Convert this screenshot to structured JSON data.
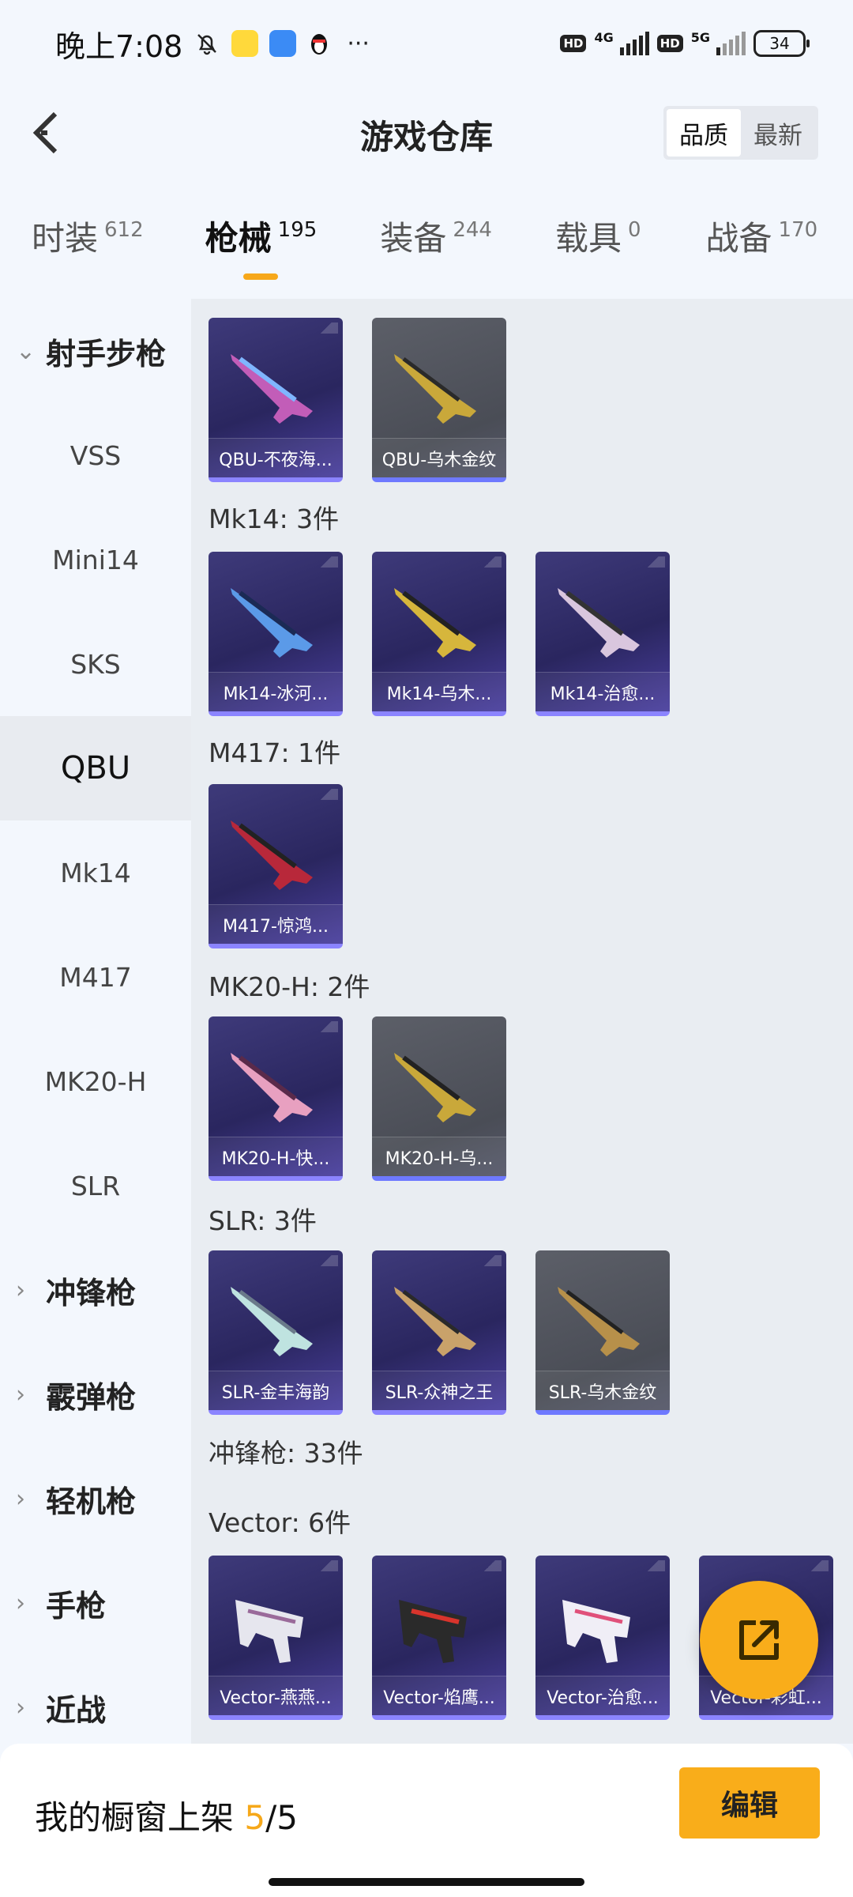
{
  "status_bar": {
    "time": "晚上7:08",
    "more": "···",
    "network1": "4G",
    "network2": "5G",
    "hd": "HD",
    "battery": "34"
  },
  "header": {
    "title": "游戏仓库",
    "sort_quality": "品质",
    "sort_newest": "最新"
  },
  "tabs": [
    {
      "label": "时装",
      "count": "612"
    },
    {
      "label": "枪械",
      "count": "195"
    },
    {
      "label": "装备",
      "count": "244"
    },
    {
      "label": "载具",
      "count": "0"
    },
    {
      "label": "战备",
      "count": "170"
    }
  ],
  "sidebar": {
    "group_sniper": "射手步枪",
    "items": [
      "VSS",
      "Mini14",
      "SKS",
      "QBU",
      "Mk14",
      "M417",
      "MK20-H",
      "SLR"
    ],
    "groups": [
      "冲锋枪",
      "霰弹枪",
      "轻机枪",
      "手枪",
      "近战"
    ]
  },
  "sections": {
    "qbu": {
      "cards": [
        "QBU-不夜海...",
        "QBU-乌木金纹"
      ]
    },
    "mk14": {
      "heading": "Mk14: 3件",
      "cards": [
        "Mk14-冰河...",
        "Mk14-乌木...",
        "Mk14-治愈..."
      ]
    },
    "m417": {
      "heading": "M417: 1件",
      "cards": [
        "M417-惊鸿..."
      ]
    },
    "mk20h": {
      "heading": "MK20-H: 2件",
      "cards": [
        "MK20-H-快...",
        "MK20-H-乌..."
      ]
    },
    "slr": {
      "heading": "SLR: 3件",
      "cards": [
        "SLR-金丰海韵",
        "SLR-众神之王",
        "SLR-乌木金纹"
      ]
    },
    "smg": {
      "heading": "冲锋枪: 33件"
    },
    "vector": {
      "heading": "Vector: 6件",
      "cards": [
        "Vector-燕燕...",
        "Vector-焰鹰...",
        "Vector-治愈...",
        "Vector-彩虹..."
      ]
    }
  },
  "bottom": {
    "shop_label": "我的橱窗上架 ",
    "shop_current": "5",
    "shop_total": "/5",
    "edit": "编辑"
  },
  "colors": {
    "accent": "#f9ad1a",
    "card_purple": "#2a265f",
    "card_grey": "#4a4d56"
  }
}
